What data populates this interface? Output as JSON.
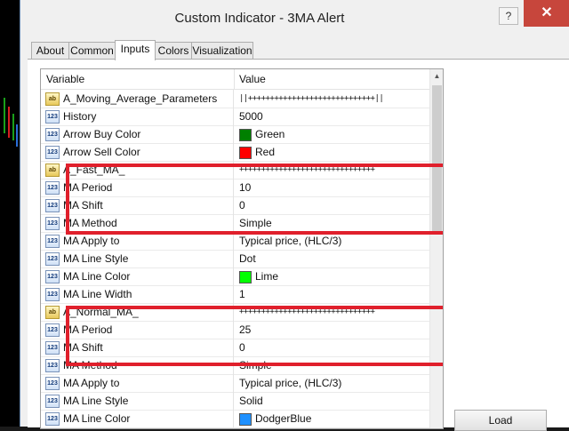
{
  "window": {
    "title": "Custom Indicator - 3MA Alert",
    "help_button": "?",
    "close_button": "✕"
  },
  "tabs": [
    {
      "label": "About"
    },
    {
      "label": "Common"
    },
    {
      "label": "Inputs",
      "active": true
    },
    {
      "label": "Colors"
    },
    {
      "label": "Visualization"
    }
  ],
  "grid": {
    "headers": {
      "variable": "Variable",
      "value": "Value"
    },
    "rows": [
      {
        "icon": "ab",
        "name": "A_Moving_Average_Parameters",
        "value": "||+++++++++++++++++++++++++++++||"
      },
      {
        "icon": "123",
        "name": "History",
        "value": "5000"
      },
      {
        "icon": "123",
        "name": "Arrow Buy Color",
        "value": "Green",
        "color": "#008000"
      },
      {
        "icon": "123",
        "name": "Arrow Sell Color",
        "value": "Red",
        "color": "#ff0000"
      },
      {
        "icon": "ab",
        "name": "A_Fast_MA_",
        "value": "+++++++++++++++++++++++++++++++"
      },
      {
        "icon": "123",
        "name": "MA Period",
        "value": "10"
      },
      {
        "icon": "123",
        "name": "MA Shift",
        "value": "0"
      },
      {
        "icon": "123",
        "name": "MA Method",
        "value": "Simple"
      },
      {
        "icon": "123",
        "name": "MA Apply to",
        "value": "Typical price, (HLC/3)"
      },
      {
        "icon": "123",
        "name": "MA Line Style",
        "value": "Dot"
      },
      {
        "icon": "123",
        "name": "MA Line Color",
        "value": "Lime",
        "color": "#00ff00"
      },
      {
        "icon": "123",
        "name": "MA Line Width",
        "value": "1"
      },
      {
        "icon": "ab",
        "name": "A_Normal_MA_",
        "value": "+++++++++++++++++++++++++++++++"
      },
      {
        "icon": "123",
        "name": "MA Period",
        "value": "25"
      },
      {
        "icon": "123",
        "name": "MA Shift",
        "value": "0"
      },
      {
        "icon": "123",
        "name": "MA Method",
        "value": "Simple"
      },
      {
        "icon": "123",
        "name": "MA Apply to",
        "value": "Typical price, (HLC/3)"
      },
      {
        "icon": "123",
        "name": "MA Line Style",
        "value": "Solid"
      },
      {
        "icon": "123",
        "name": "MA Line Color",
        "value": "DodgerBlue",
        "color": "#1e90ff"
      }
    ]
  },
  "buttons": {
    "load": "Load"
  },
  "colors": {
    "highlight": "#e0202c",
    "close": "#c7463c"
  }
}
